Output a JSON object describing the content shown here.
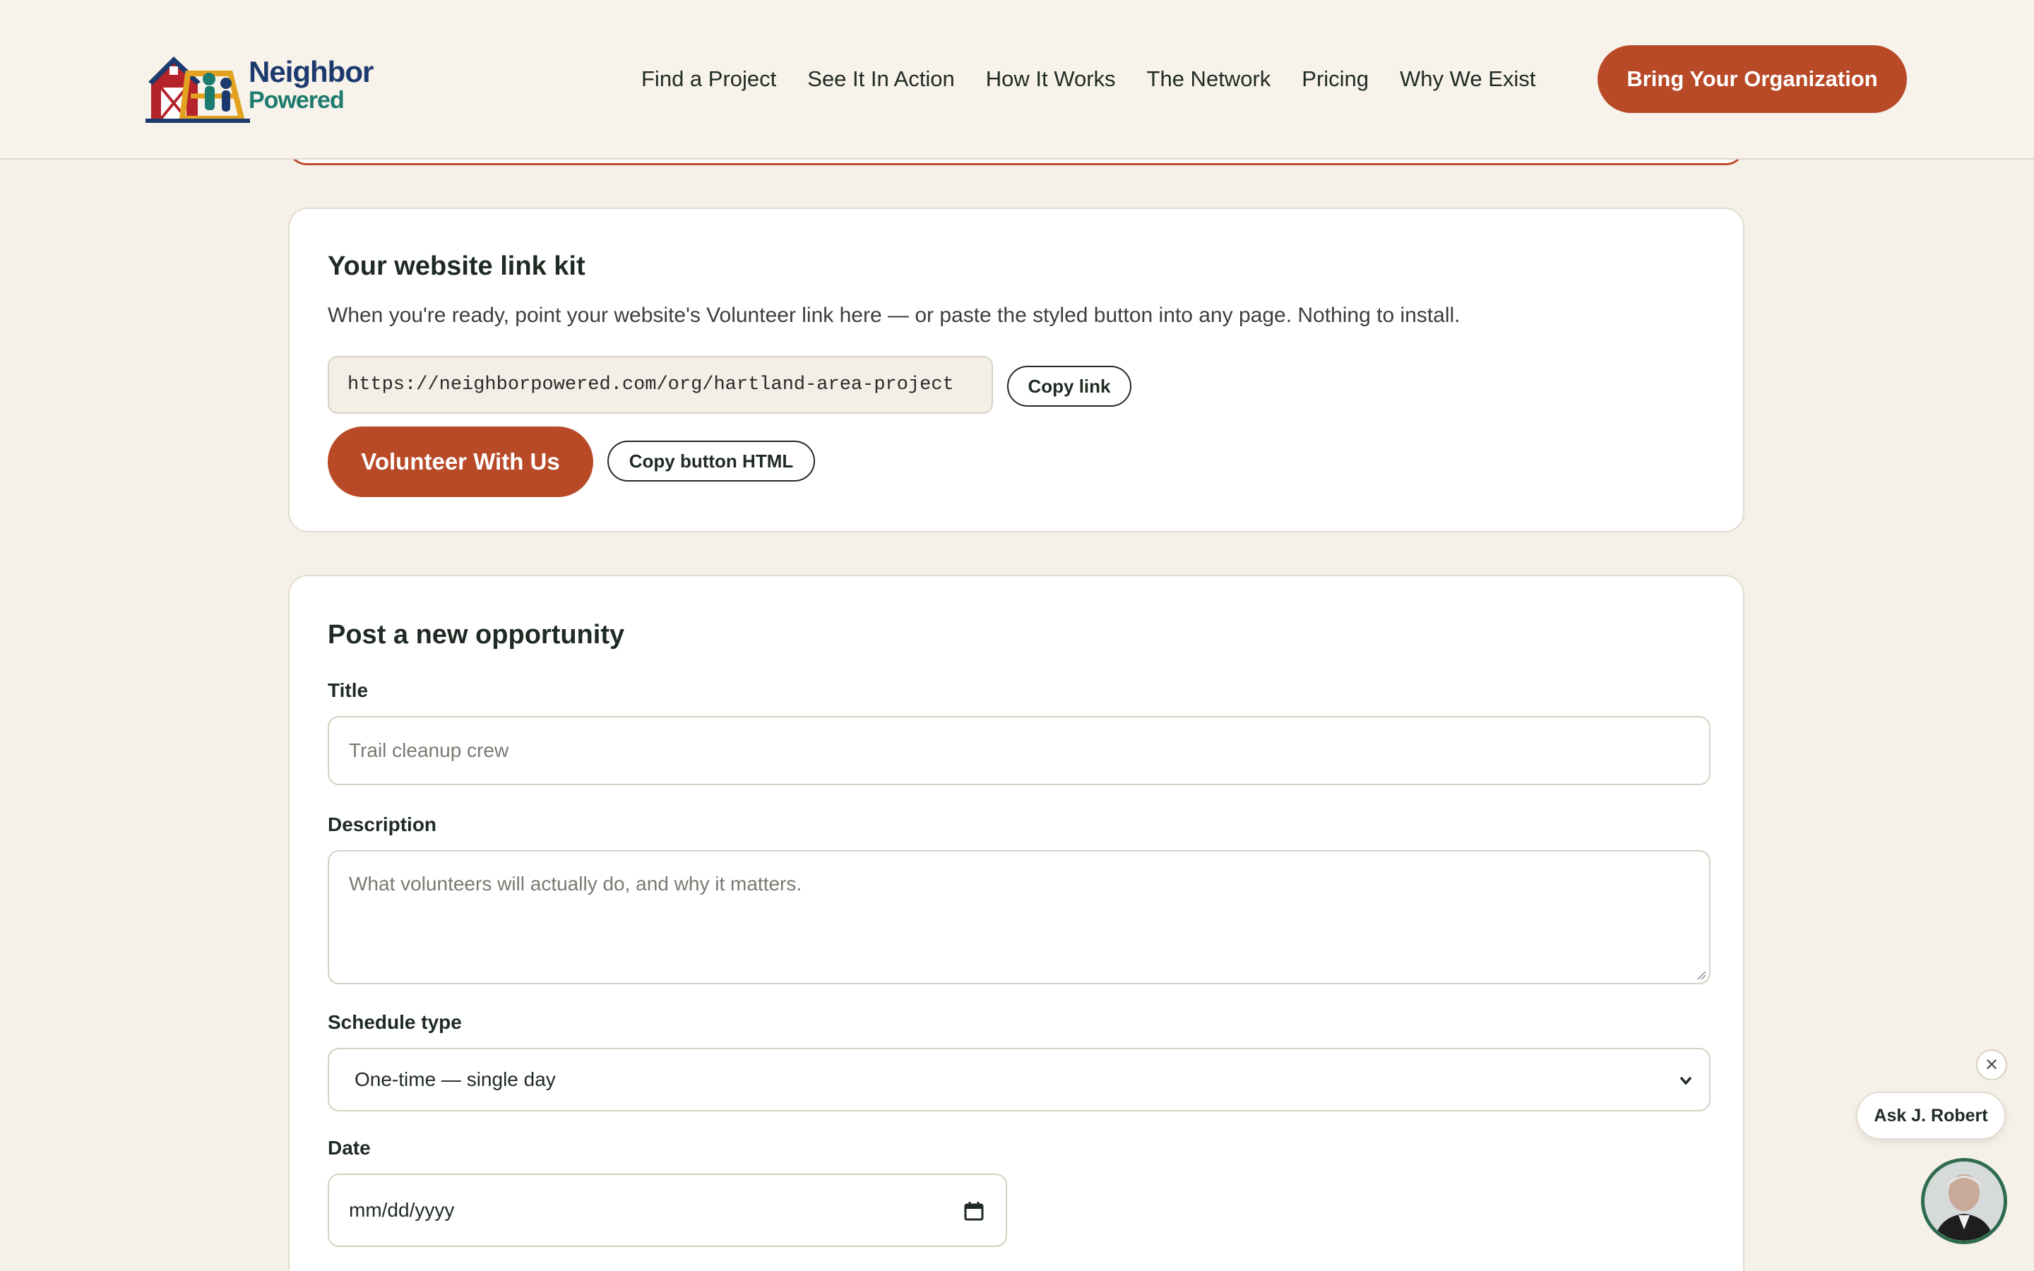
{
  "header": {
    "logo_line1": "Neighbor",
    "logo_line2": "Powered",
    "nav": [
      "Find a Project",
      "See It In Action",
      "How It Works",
      "The Network",
      "Pricing",
      "Why We Exist"
    ],
    "cta_label": "Bring Your Organization"
  },
  "link_kit": {
    "title": "Your website link kit",
    "description": "When you're ready, point your website's Volunteer link here — or paste the styled button into any page. Nothing to install.",
    "url": "https://neighborpowered.com/org/hartland-area-project",
    "copy_link_label": "Copy link",
    "volunteer_button_label": "Volunteer With Us",
    "copy_html_label": "Copy button HTML"
  },
  "form": {
    "title": "Post a new opportunity",
    "title_label": "Title",
    "title_placeholder": "Trail cleanup crew",
    "description_label": "Description",
    "description_placeholder": "What volunteers will actually do, and why it matters.",
    "schedule_label": "Schedule type",
    "schedule_value": "One-time — single day",
    "date_label": "Date",
    "date_placeholder": "mm/dd/yyyy"
  },
  "chat": {
    "bubble_label": "Ask J. Robert",
    "close_glyph": "✕"
  },
  "colors": {
    "accent": "#b84a28",
    "background": "#f5f0e8",
    "brand_navy": "#1d3a6e",
    "brand_teal": "#1d7a6e"
  }
}
